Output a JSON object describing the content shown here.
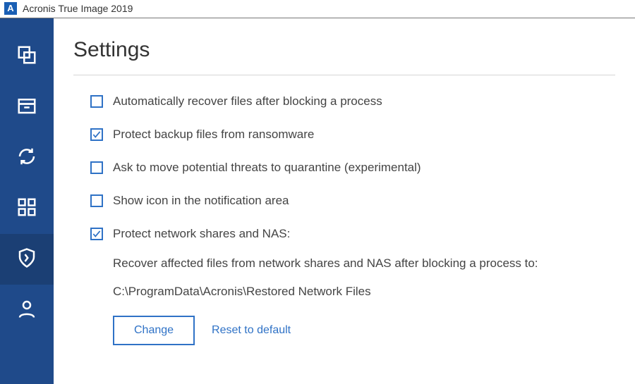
{
  "window": {
    "title": "Acronis True Image 2019",
    "logo_letter": "A"
  },
  "sidebar": {
    "items": [
      {
        "id": "backup",
        "icon": "copy-icon"
      },
      {
        "id": "archive",
        "icon": "archive-icon"
      },
      {
        "id": "sync",
        "icon": "sync-icon"
      },
      {
        "id": "tools",
        "icon": "grid-icon"
      },
      {
        "id": "protect",
        "icon": "shield-icon",
        "active": true
      },
      {
        "id": "account",
        "icon": "user-icon"
      }
    ]
  },
  "page": {
    "title": "Settings",
    "settings": [
      {
        "id": "auto_recover",
        "label": "Automatically recover files after blocking a process",
        "checked": false
      },
      {
        "id": "protect_backup",
        "label": "Protect backup files from ransomware",
        "checked": true
      },
      {
        "id": "quarantine",
        "label": "Ask to move potential threats to quarantine (experimental)",
        "checked": false
      },
      {
        "id": "tray_icon",
        "label": "Show icon in the notification area",
        "checked": false
      },
      {
        "id": "protect_nas",
        "label": "Protect network shares and NAS:",
        "checked": true
      }
    ],
    "nas": {
      "description": "Recover affected files from network shares and NAS after blocking a process to:",
      "path": "C:\\ProgramData\\Acronis\\Restored Network Files",
      "change_label": "Change",
      "reset_label": "Reset to default"
    }
  }
}
